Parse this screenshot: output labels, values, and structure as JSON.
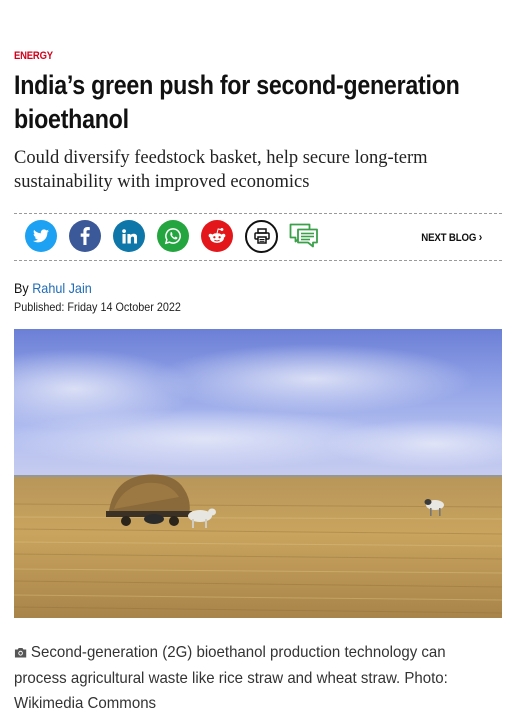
{
  "article": {
    "category": "ENERGY",
    "headline": "India’s green push for second-generation bioethanol",
    "subheadline": "Could diversify feedstock basket, help secure long-term sustainability with improved economics",
    "byline_prefix": "By",
    "author": "Rahul Jain",
    "published": "Published: Friday 14 October 2022",
    "caption": "Second-generation (2G) bioethanol production technology can process agricultural waste like rice straw and wheat straw. Photo: Wikimedia Commons"
  },
  "share": {
    "buttons": [
      {
        "name": "twitter",
        "icon": "twitter-icon",
        "color": "#1da1f2"
      },
      {
        "name": "facebook",
        "icon": "facebook-icon",
        "color": "#3b5998"
      },
      {
        "name": "linkedin",
        "icon": "linkedin-icon",
        "color": "#0e76a8"
      },
      {
        "name": "whatsapp",
        "icon": "whatsapp-icon",
        "color": "#25a53f"
      },
      {
        "name": "reddit",
        "icon": "reddit-icon",
        "color": "#e3171b"
      },
      {
        "name": "print",
        "icon": "print-icon",
        "color": "#111111"
      },
      {
        "name": "comments",
        "icon": "comments-icon",
        "color": "#3aa14a"
      }
    ],
    "next_blog_label": "NEXT BLOG"
  },
  "colors": {
    "category": "#d0021b",
    "author_link": "#1e6bb8",
    "divider": "#9a9a9a"
  }
}
